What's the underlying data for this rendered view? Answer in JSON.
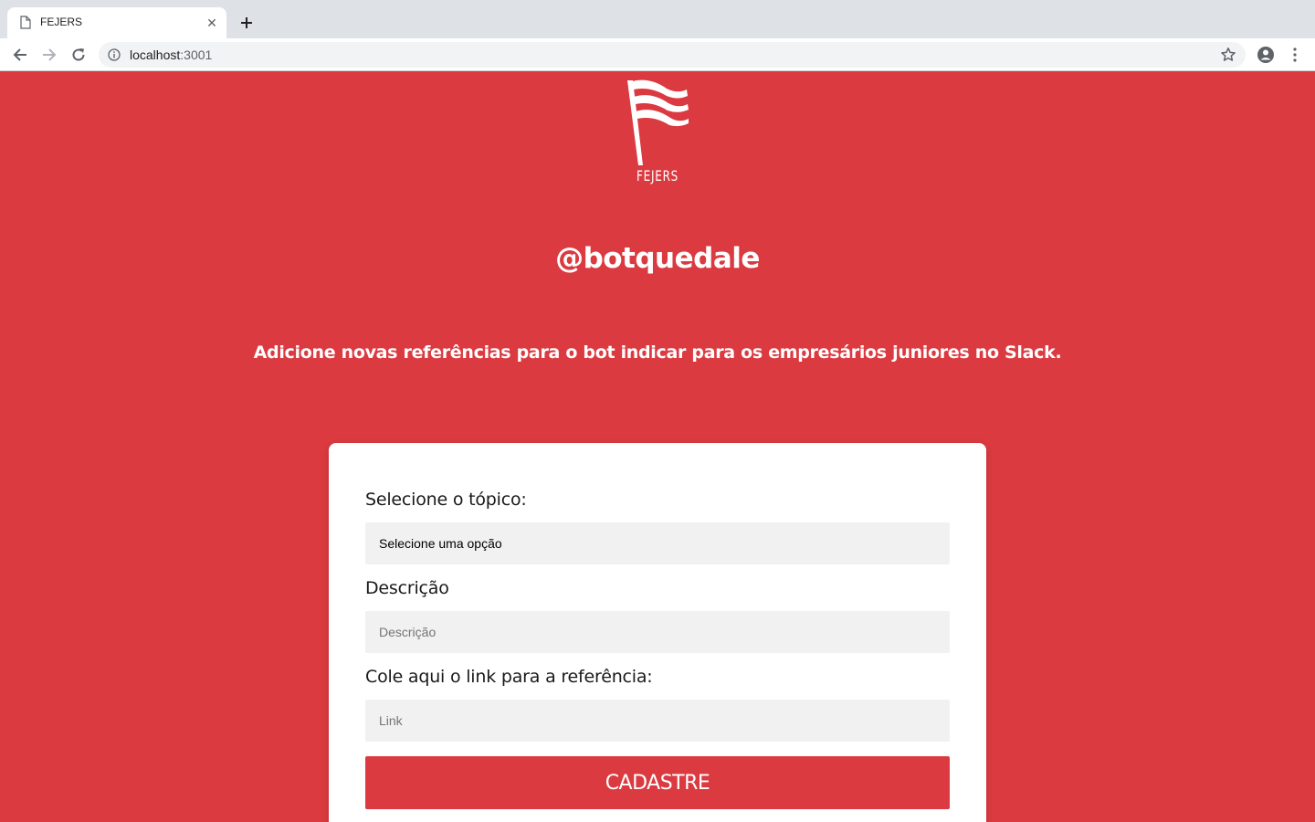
{
  "browser": {
    "tab_title": "FEJERS",
    "url_host": "localhost",
    "url_port": ":3001"
  },
  "page": {
    "logo_text": "FEJERS",
    "title": "@botquedale",
    "subtitle": "Adicione novas referências para o bot indicar para os empresários juniores no Slack."
  },
  "form": {
    "topic_label": "Selecione o tópico:",
    "topic_selected": "Selecione uma opção",
    "description_label": "Descrição",
    "description_placeholder": "Descrição",
    "link_label": "Cole aqui o link para a referência:",
    "link_placeholder": "Link",
    "submit_label": "CADASTRE"
  },
  "colors": {
    "brand_red": "#db3a40",
    "field_bg": "#f1f1f1"
  }
}
